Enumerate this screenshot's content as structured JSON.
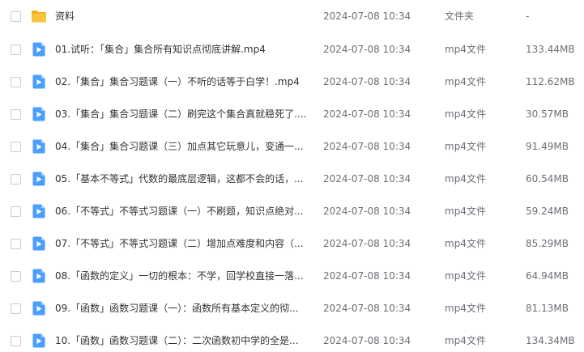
{
  "files": [
    {
      "icon": "folder-icon",
      "name": "资料",
      "date": "2024-07-08 10:34",
      "type": "文件夹",
      "size": "-"
    },
    {
      "icon": "video-file-icon",
      "name": "01.试听：「集合」集合所有知识点彻底讲解.mp4",
      "date": "2024-07-08 10:34",
      "type": "mp4文件",
      "size": "133.44MB"
    },
    {
      "icon": "video-file-icon",
      "name": "02.「集合」集合习题课（一）不听的话等于白学！.mp4",
      "date": "2024-07-08 10:34",
      "type": "mp4文件",
      "size": "112.62MB"
    },
    {
      "icon": "video-file-icon",
      "name": "03.「集合」集合习题课（二）刷完这个集合真就稳死了....",
      "date": "2024-07-08 10:34",
      "type": "mp4文件",
      "size": "30.57MB"
    },
    {
      "icon": "video-file-icon",
      "name": "04.「集合」集合习题课（三）加点其它玩意儿，变通一...",
      "date": "2024-07-08 10:34",
      "type": "mp4文件",
      "size": "91.49MB"
    },
    {
      "icon": "video-file-icon",
      "name": "05.「基本不等式」代数的最底层逻辑，这都不会的话，...",
      "date": "2024-07-08 10:34",
      "type": "mp4文件",
      "size": "60.54MB"
    },
    {
      "icon": "video-file-icon",
      "name": "06.「不等式」不等式习题课（一）不刷题，知识点绝对...",
      "date": "2024-07-08 10:34",
      "type": "mp4文件",
      "size": "59.24MB"
    },
    {
      "icon": "video-file-icon",
      "name": "07.「不等式」不等式习题课（二）增加点难度和内容（...",
      "date": "2024-07-08 10:34",
      "type": "mp4文件",
      "size": "85.29MB"
    },
    {
      "icon": "video-file-icon",
      "name": "08.「函数的定义」一切的根本：不学，回学校直接一落...",
      "date": "2024-07-08 10:34",
      "type": "mp4文件",
      "size": "64.94MB"
    },
    {
      "icon": "video-file-icon",
      "name": "09.「函数」函数习题课（一）：函数所有基本定义的彻...",
      "date": "2024-07-08 10:34",
      "type": "mp4文件",
      "size": "81.13MB"
    },
    {
      "icon": "video-file-icon",
      "name": "10.「函数」函数习题课（二）：二次函数初中学的全是...",
      "date": "2024-07-08 10:34",
      "type": "mp4文件",
      "size": "134.34MB"
    }
  ],
  "colors": {
    "folder": "#f9c33d",
    "folder_tab": "#f5ad1c",
    "video": "#4a9eff",
    "text_primary": "#333333",
    "text_secondary": "#6b6f76"
  }
}
